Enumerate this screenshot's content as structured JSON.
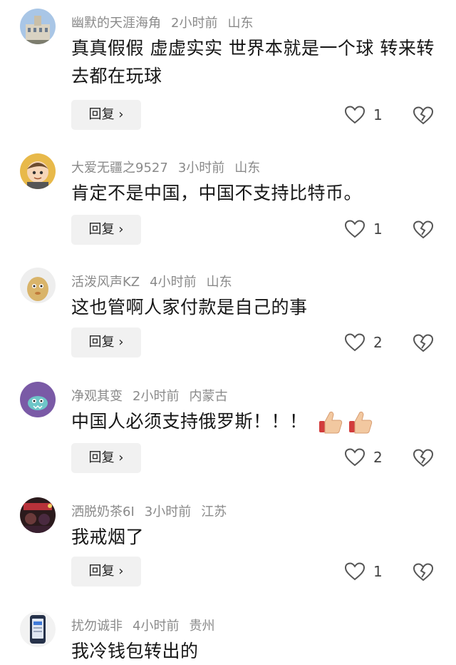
{
  "comments": [
    {
      "user": "幽默的天涯海角",
      "time": "2小时前",
      "location": "山东",
      "text": "真真假假 虚虚实实 世界本就是一个球 转来转去都在玩球",
      "reply_label": "回复 ›",
      "likes": "1",
      "avatar": "building-avatar"
    },
    {
      "user": "大爱无疆之9527",
      "time": "3小时前",
      "location": "山东",
      "text": "肯定不是中国，中国不支持比特币。",
      "reply_label": "回复 ›",
      "likes": "1",
      "avatar": "cartoon-boy-avatar"
    },
    {
      "user": "活泼风声KZ",
      "time": "4小时前",
      "location": "山东",
      "text": "这也管啊人家付款是自己的事",
      "reply_label": "回复 ›",
      "likes": "2",
      "avatar": "yellow-creature-avatar"
    },
    {
      "user": "净观其变",
      "time": "2小时前",
      "location": "内蒙古",
      "text": "中国人必须支持俄罗斯！！！",
      "emoji": [
        "thumbs-up-emoji",
        "thumbs-up-emoji"
      ],
      "reply_label": "回复 ›",
      "likes": "2",
      "avatar": "purple-monster-avatar"
    },
    {
      "user": "洒脱奶茶6I",
      "time": "3小时前",
      "location": "江苏",
      "text": "我戒烟了",
      "reply_label": "回复 ›",
      "likes": "1",
      "avatar": "night-photo-avatar"
    },
    {
      "user": "扰勿诚非",
      "time": "4小时前",
      "location": "贵州",
      "text": "我冷钱包转出的",
      "avatar": "phone-wallet-avatar"
    }
  ],
  "colors": {
    "meta": "#8a8a8a",
    "text": "#161616",
    "reply_bg": "#f1f1f1"
  }
}
